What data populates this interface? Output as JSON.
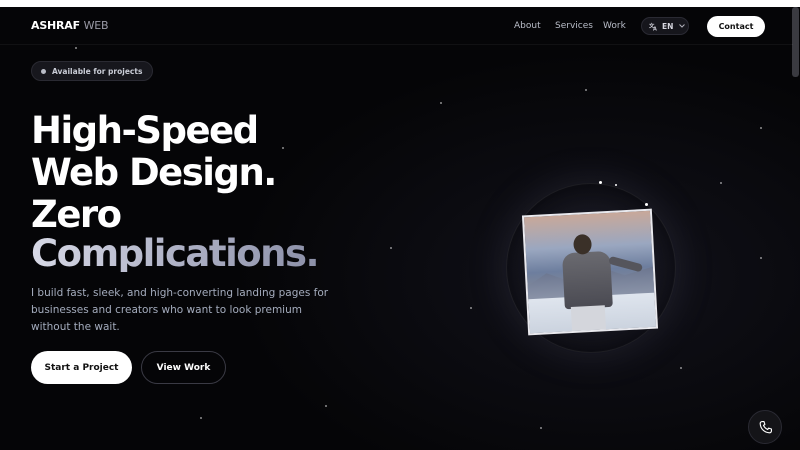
{
  "nav": {
    "logo_primary": "ASHRAF",
    "logo_secondary": "WEB",
    "links": [
      "About",
      "Services",
      "Work"
    ],
    "lang_label": "EN",
    "contact_label": "Contact"
  },
  "hero": {
    "badge": "Available for projects",
    "headline": [
      "High-Speed",
      "Web Design.",
      "Zero",
      "Complications."
    ],
    "subtitle": "I build fast, sleek, and high-converting landing pages for businesses and creators who want to look premium without the wait.",
    "primary_cta": "Start a Project",
    "secondary_cta": "View Work"
  },
  "colors": {
    "background": "#050507",
    "text": "#ffffff",
    "muted": "#a4acbd"
  },
  "icons": [
    "translate-icon",
    "chevron-down-icon",
    "phone-icon"
  ]
}
